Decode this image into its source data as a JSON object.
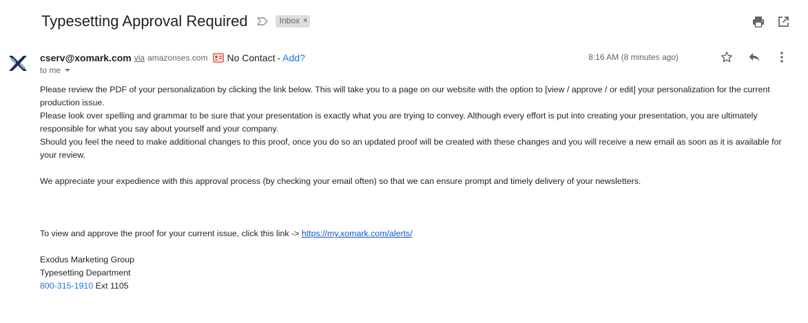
{
  "subject": "Typesetting Approval Required",
  "label": {
    "name": "Inbox",
    "remove": "×"
  },
  "actions": {
    "print_icon": "printer-icon",
    "new_window_icon": "open-in-new-window-icon"
  },
  "sender": {
    "email": "cserv@xomark.com",
    "via": "via",
    "via_domain": "amazonses.com",
    "contact_status": "No Contact",
    "dash": "-",
    "add_label": "Add?",
    "recipient": "to me"
  },
  "timestamp": "8:16 AM (8 minutes ago)",
  "colors": {
    "link": "#1155cc",
    "accent": "#1a73e8",
    "chip_bg": "#dddddd",
    "avatar_blue": "#1a2a5c",
    "avatar_steel": "#8fa9c8"
  },
  "body": {
    "p1": "Please review the PDF of your personalization by clicking the link below. This will take you to a page on our website with the option to [view / approve / or edit] your personalization for the current production issue.",
    "p2": "Please look over spelling and grammar to be sure that your presentation is exactly what you are trying to convey. Although every effort is put into creating your presentation, you are ultimately responsible for what you say about yourself and your company.",
    "p3": "Should you feel the need to make additional changes to this proof, once you do so an updated proof will be created with these changes and you will receive a new email as soon as it is available for your review.",
    "p4": "We appreciate your expedience with this approval process (by checking your email often) so that we can ensure prompt and timely delivery of your newsletters.",
    "link_intro": "To view and approve the proof for your current issue, click this link -> ",
    "link_url": "https://my.xomark.com/alerts/",
    "sig_company": "Exodus Marketing Group",
    "sig_dept": "Typesetting Department",
    "phone": "800-315-1910",
    "ext": " Ext 1105"
  }
}
